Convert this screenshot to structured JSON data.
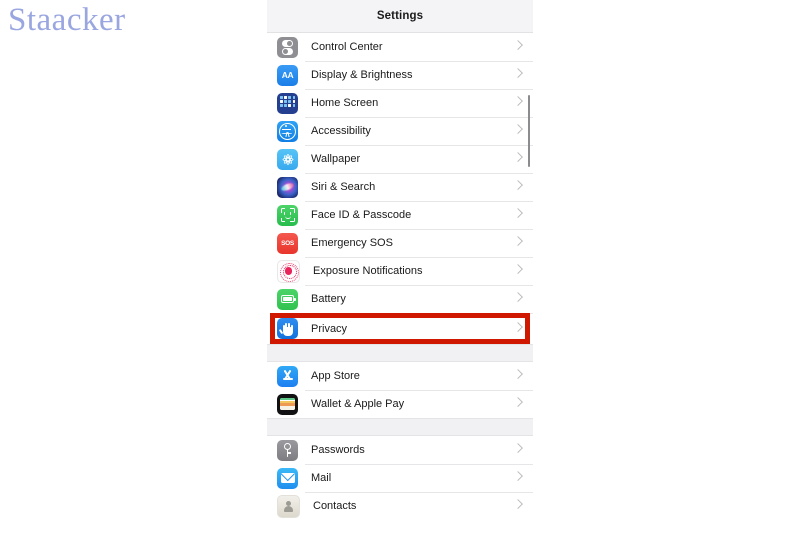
{
  "watermark": {
    "text": "Staacker"
  },
  "settings": {
    "header_title": "Settings",
    "sections": [
      {
        "id": "section-main",
        "rows": [
          {
            "label": "Control Center",
            "icon": "control-center-icon",
            "icon_class": "ic-control",
            "highlighted": false
          },
          {
            "label": "Display & Brightness",
            "icon": "display-brightness-icon",
            "icon_class": "ic-display",
            "highlighted": false
          },
          {
            "label": "Home Screen",
            "icon": "home-screen-icon",
            "icon_class": "ic-home",
            "highlighted": false
          },
          {
            "label": "Accessibility",
            "icon": "accessibility-icon",
            "icon_class": "ic-access",
            "highlighted": false
          },
          {
            "label": "Wallpaper",
            "icon": "wallpaper-icon",
            "icon_class": "ic-wallpaper",
            "highlighted": false
          },
          {
            "label": "Siri & Search",
            "icon": "siri-search-icon",
            "icon_class": "ic-siri",
            "highlighted": false
          },
          {
            "label": "Face ID & Passcode",
            "icon": "face-id-icon",
            "icon_class": "ic-faceid",
            "highlighted": false
          },
          {
            "label": "Emergency SOS",
            "icon": "emergency-sos-icon",
            "icon_class": "ic-sos",
            "highlighted": false
          },
          {
            "label": "Exposure Notifications",
            "icon": "exposure-notifications-icon",
            "icon_class": "ic-exposure",
            "highlighted": false
          },
          {
            "label": "Battery",
            "icon": "battery-icon",
            "icon_class": "ic-battery",
            "highlighted": false
          },
          {
            "label": "Privacy",
            "icon": "privacy-hand-icon",
            "icon_class": "ic-privacy",
            "highlighted": true
          }
        ]
      },
      {
        "id": "section-store",
        "rows": [
          {
            "label": "App Store",
            "icon": "app-store-icon",
            "icon_class": "ic-appstore",
            "highlighted": false
          },
          {
            "label": "Wallet & Apple Pay",
            "icon": "wallet-icon",
            "icon_class": "ic-wallet",
            "highlighted": false
          }
        ]
      },
      {
        "id": "section-accounts",
        "rows": [
          {
            "label": "Passwords",
            "icon": "passwords-key-icon",
            "icon_class": "ic-passwords",
            "highlighted": false
          },
          {
            "label": "Mail",
            "icon": "mail-icon",
            "icon_class": "ic-mail",
            "highlighted": false
          },
          {
            "label": "Contacts",
            "icon": "contacts-icon",
            "icon_class": "ic-contacts",
            "highlighted": false
          }
        ]
      }
    ],
    "highlight_color": "#d01700",
    "scrollbar_color": "#8c8c8e"
  }
}
